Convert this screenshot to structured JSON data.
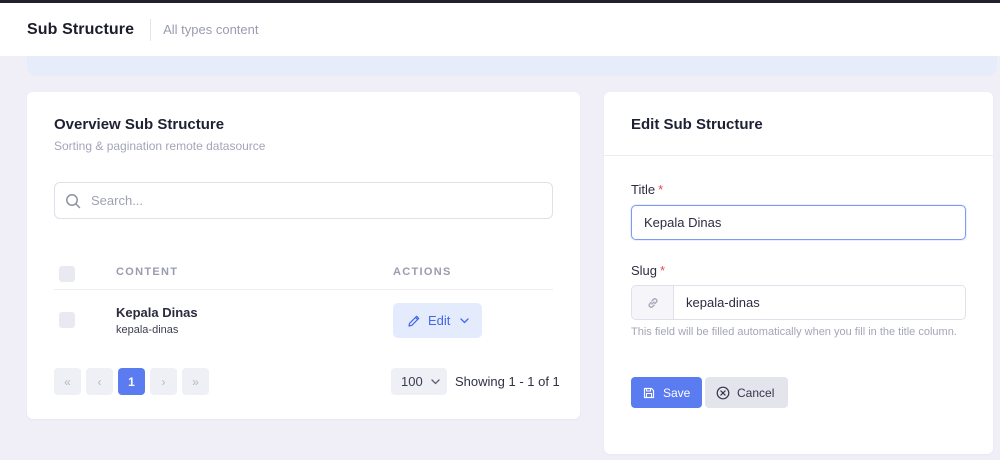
{
  "header": {
    "title": "Sub Structure",
    "subtitle": "All types content"
  },
  "overview": {
    "title": "Overview Sub Structure",
    "subtitle": "Sorting & pagination remote datasource",
    "search": {
      "placeholder": "Search...",
      "value": ""
    },
    "columns": {
      "content": "CONTENT",
      "actions": "ACTIONS"
    },
    "rows": [
      {
        "title": "Kepala Dinas",
        "slug": "kepala-dinas",
        "action_label": "Edit"
      }
    ],
    "pagination": {
      "first": "«",
      "prev": "‹",
      "current_page": "1",
      "next": "›",
      "last": "»",
      "per_page": "100",
      "showing": "Showing 1 - 1 of 1"
    }
  },
  "edit": {
    "title": "Edit Sub Structure",
    "title_label": "Title",
    "title_value": "Kepala Dinas",
    "slug_label": "Slug",
    "slug_value": "kepala-dinas",
    "required_mark": "*",
    "help_text": "This field will be filled automatically when you fill in the title column.",
    "save_label": "Save",
    "cancel_label": "Cancel"
  },
  "icons": {
    "search": "search-icon",
    "pencil": "pencil-icon",
    "chevron": "chevron-down-icon",
    "link": "link-icon",
    "save": "floppy-disk-icon",
    "cancel": "x-circle-icon"
  },
  "colors": {
    "accent": "#5b7bf0",
    "required": "#e8475c",
    "background": "#f0eef7"
  }
}
